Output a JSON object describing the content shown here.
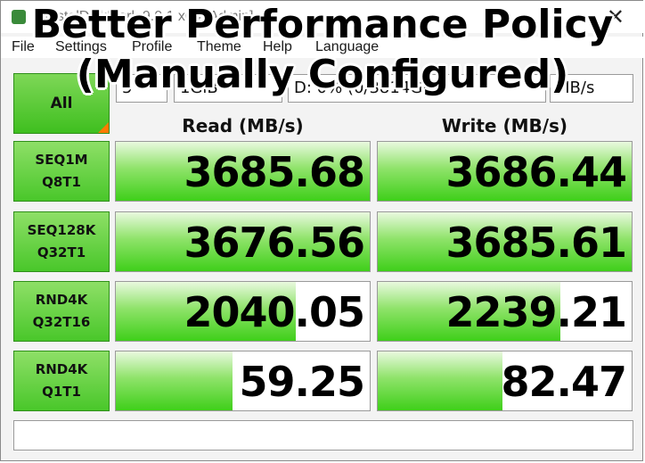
{
  "overlay": {
    "line1": "Better Performance Policy",
    "line2": "(Manually Configured)"
  },
  "window": {
    "title": "CrystalDiskMark 9.0.1 x64 [Admin]",
    "close_symbol": "✕"
  },
  "menu": [
    "File",
    "Settings",
    "Profile",
    "Theme",
    "Help",
    "Language"
  ],
  "controls": {
    "all_label": "All",
    "count": "5",
    "size": "1GiB",
    "drive": "D: 0% (0/3814GiB)",
    "unit": "MB/s"
  },
  "headers": {
    "read": "Read (MB/s)",
    "write": "Write (MB/s)"
  },
  "tests": [
    {
      "line1": "SEQ1M",
      "line2": "Q8T1",
      "read": "3685.68",
      "write": "3686.44",
      "read_fill": 1.0,
      "write_fill": 1.0
    },
    {
      "line1": "SEQ128K",
      "line2": "Q32T1",
      "read": "3676.56",
      "write": "3685.61",
      "read_fill": 1.0,
      "write_fill": 1.0
    },
    {
      "line1": "RND4K",
      "line2": "Q32T16",
      "read": "2040.05",
      "write": "2239.21",
      "read_fill": 0.71,
      "write_fill": 0.72
    },
    {
      "line1": "RND4K",
      "line2": "Q1T1",
      "read": "59.25",
      "write": "82.47",
      "read_fill": 0.46,
      "write_fill": 0.49
    }
  ],
  "status": ""
}
